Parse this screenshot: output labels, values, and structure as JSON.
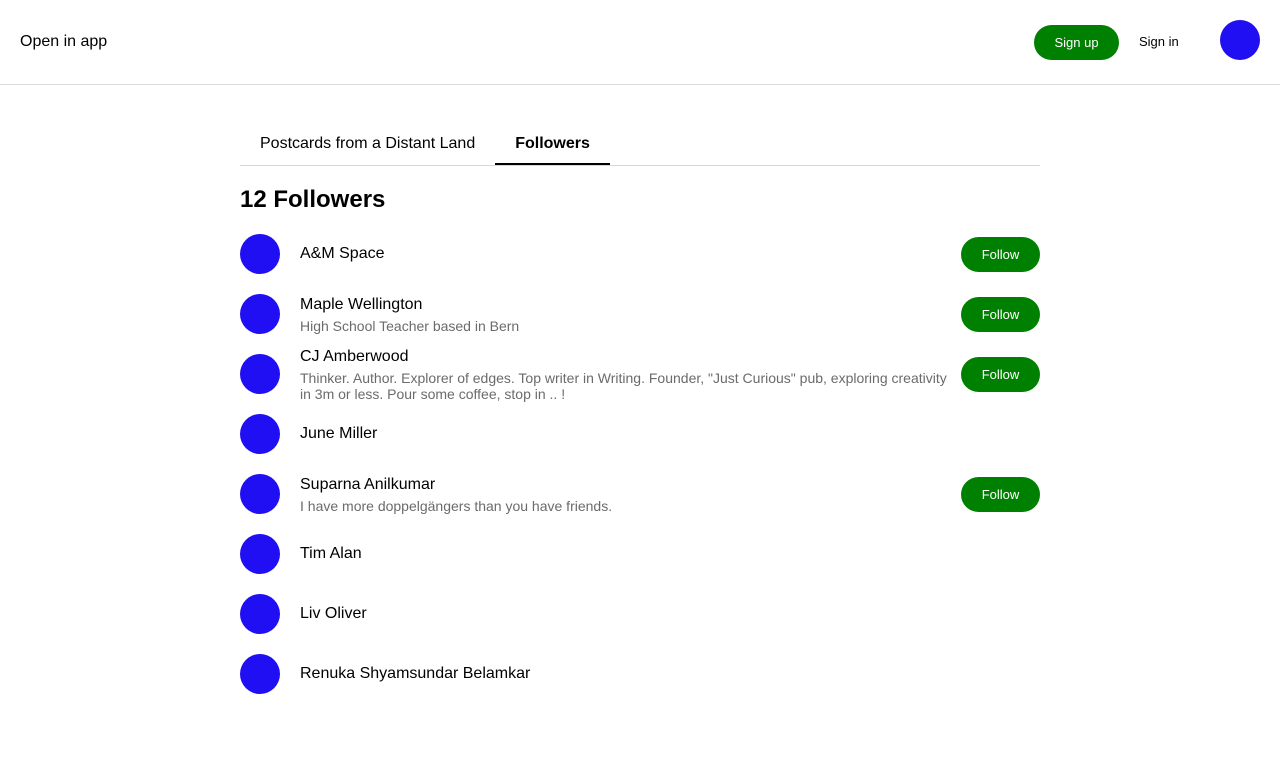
{
  "header": {
    "open_in_app": "Open in app",
    "signup_label": "Sign up",
    "signin_label": "Sign in"
  },
  "tabs": [
    {
      "label": "Postcards from a Distant Land",
      "active": false
    },
    {
      "label": "Followers",
      "active": true
    }
  ],
  "followers_title": "12 Followers",
  "followers": [
    {
      "name": "A&M Space",
      "bio": "",
      "follow_label": "Follow"
    },
    {
      "name": "Maple Wellington",
      "bio": "High School Teacher based in Bern",
      "follow_label": "Follow"
    },
    {
      "name": "CJ Amberwood",
      "bio": "Thinker. Author. Explorer of edges. Top writer in Writing. Founder, \"Just Curious\" pub, exploring creativity in 3m or less. Pour some coffee, stop in .. !",
      "follow_label": "Follow"
    },
    {
      "name": "June Miller",
      "bio": "",
      "follow_label": ""
    },
    {
      "name": "Suparna Anilkumar",
      "bio": "I have more doppelgängers than you have friends.",
      "follow_label": "Follow"
    },
    {
      "name": "Tim Alan",
      "bio": "",
      "follow_label": ""
    },
    {
      "name": "Liv Oliver",
      "bio": "",
      "follow_label": ""
    },
    {
      "name": "Renuka Shyamsundar Belamkar",
      "bio": "",
      "follow_label": ""
    }
  ],
  "colors": {
    "accent_green": "#008000",
    "avatar_blue": "#1f0ff2",
    "bio_gray": "#6b6b6b"
  }
}
